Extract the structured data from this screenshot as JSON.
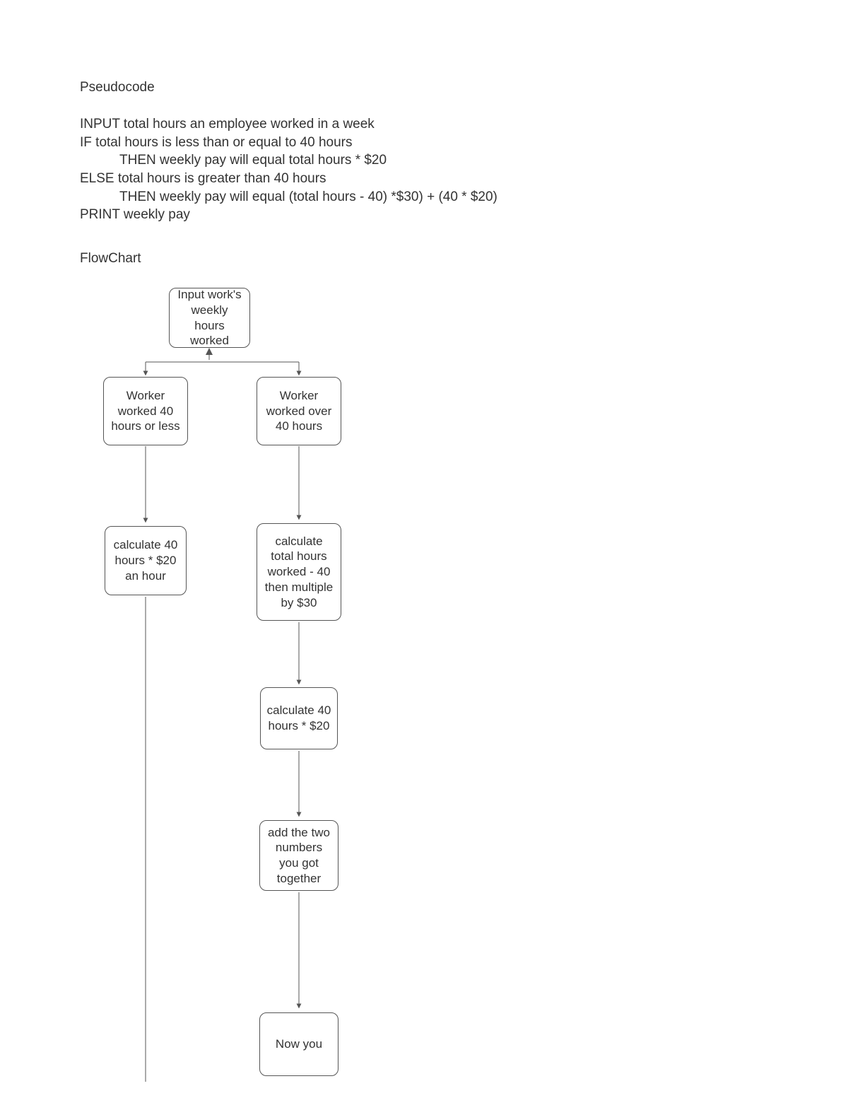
{
  "headings": {
    "pseudo": "Pseudocode",
    "flow": "FlowChart"
  },
  "pseudo": {
    "l1": "INPUT total hours an employee worked in a week",
    "l2": "IF total hours is less than or equal to 40 hours",
    "l3": "THEN weekly pay will equal total hours * $20",
    "l4": "ELSE total hours is greater than 40 hours",
    "l5": "THEN weekly pay will equal (total hours - 40) *$30) + (40 * $20)",
    "l6": "PRINT weekly pay"
  },
  "boxes": {
    "input": "Input work's weekly hours worked",
    "left1": "Worker worked 40 hours or less",
    "right1": "Worker worked over 40 hours",
    "left2": "calculate 40 hours * $20 an hour",
    "right2": "calculate total hours worked - 40 then multiple by $30",
    "right3": "calculate 40 hours * $20",
    "right4": "add the two numbers you got together",
    "bottom": "Now you"
  }
}
